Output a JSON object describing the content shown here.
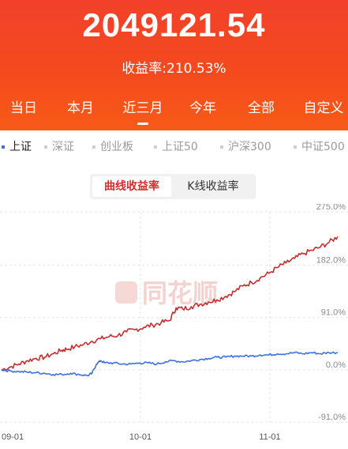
{
  "header": {
    "total_value": "2049121.54",
    "return_ratio": "收益率:210.53%"
  },
  "tabs": [
    "当日",
    "本月",
    "近三月",
    "今年",
    "全部",
    "自定义"
  ],
  "active_tab": "近三月",
  "index_options": [
    {
      "label": "上证",
      "active": true
    },
    {
      "label": "深证",
      "active": false
    },
    {
      "label": "创业板",
      "active": false
    },
    {
      "label": "上证50",
      "active": false
    },
    {
      "label": "沪深300",
      "active": false
    },
    {
      "label": "中证500",
      "active": false
    }
  ],
  "toggle": {
    "selected": "曲线收益率",
    "other": "K线收益率"
  },
  "watermark": "同花顺",
  "colors": {
    "header_red": "#f2402a",
    "portfolio_line": "#c62e2e",
    "index_line": "#3b72e0",
    "active_dot": "#3b72e0"
  },
  "chart_data": {
    "type": "line",
    "y_tick_labels": [
      "275.0%",
      "182.0%",
      "91.0%",
      "0.0%",
      "-91.0%"
    ],
    "y_ticks": [
      275,
      182,
      91,
      0,
      -91
    ],
    "ylim": [
      -91,
      275
    ],
    "x_tick_labels": [
      "09-01",
      "10-01",
      "11-01"
    ],
    "series": [
      {
        "name": "",
        "color": "#c62e2e",
        "points": [
          [
            0,
            0
          ],
          [
            4,
            5
          ],
          [
            8,
            10
          ],
          [
            12,
            16
          ],
          [
            16,
            20
          ],
          [
            20,
            22
          ],
          [
            24,
            28
          ],
          [
            28,
            34
          ],
          [
            30,
            36
          ],
          [
            34,
            40
          ],
          [
            38,
            44
          ],
          [
            42,
            50
          ],
          [
            46,
            54
          ],
          [
            50,
            58
          ],
          [
            54,
            60
          ],
          [
            58,
            66
          ],
          [
            62,
            70
          ],
          [
            66,
            74
          ],
          [
            70,
            78
          ],
          [
            74,
            82
          ],
          [
            78,
            86
          ],
          [
            81,
            108
          ],
          [
            84,
            106
          ],
          [
            88,
            110
          ],
          [
            92,
            114
          ],
          [
            96,
            118
          ],
          [
            100,
            122
          ],
          [
            104,
            128
          ],
          [
            108,
            136
          ],
          [
            112,
            146
          ],
          [
            116,
            152
          ],
          [
            120,
            160
          ],
          [
            124,
            168
          ],
          [
            128,
            178
          ],
          [
            132,
            186
          ],
          [
            136,
            194
          ],
          [
            140,
            202
          ],
          [
            144,
            208
          ],
          [
            148,
            214
          ],
          [
            152,
            222
          ],
          [
            156,
            232
          ]
        ]
      },
      {
        "name": "",
        "color": "#3b72e0",
        "points": [
          [
            0,
            0
          ],
          [
            4,
            -2
          ],
          [
            8,
            -3
          ],
          [
            12,
            -4
          ],
          [
            16,
            -5
          ],
          [
            20,
            -6
          ],
          [
            24,
            -8
          ],
          [
            28,
            -8
          ],
          [
            32,
            -6
          ],
          [
            36,
            -8
          ],
          [
            40,
            -10
          ],
          [
            42,
            -6
          ],
          [
            44,
            10
          ],
          [
            46,
            16
          ],
          [
            48,
            12
          ],
          [
            52,
            12
          ],
          [
            56,
            10
          ],
          [
            60,
            10
          ],
          [
            64,
            12
          ],
          [
            68,
            12
          ],
          [
            72,
            10
          ],
          [
            76,
            14
          ],
          [
            80,
            16
          ],
          [
            84,
            14
          ],
          [
            88,
            16
          ],
          [
            92,
            18
          ],
          [
            96,
            20
          ],
          [
            100,
            22
          ],
          [
            104,
            22
          ],
          [
            108,
            24
          ],
          [
            112,
            24
          ],
          [
            116,
            24
          ],
          [
            120,
            26
          ],
          [
            124,
            26
          ],
          [
            128,
            28
          ],
          [
            132,
            28
          ],
          [
            136,
            30
          ],
          [
            140,
            28
          ],
          [
            144,
            30
          ],
          [
            148,
            28
          ],
          [
            152,
            30
          ],
          [
            156,
            30
          ]
        ]
      }
    ]
  }
}
